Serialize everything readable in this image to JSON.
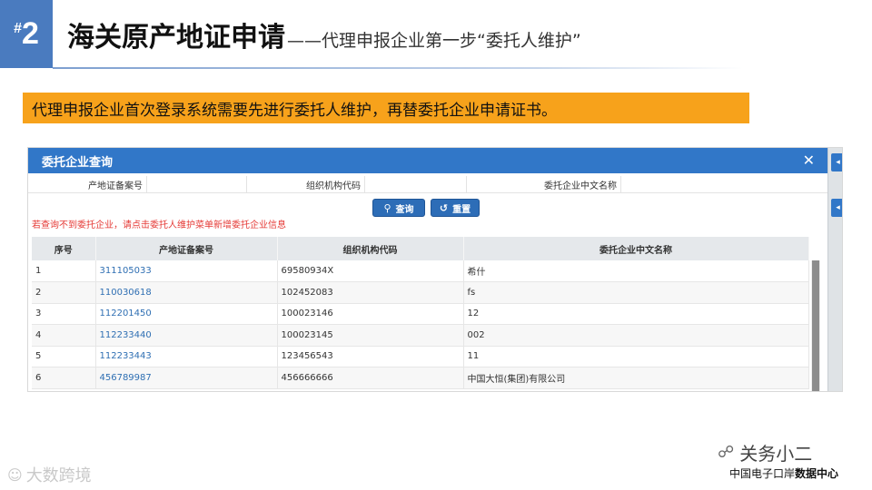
{
  "slide": {
    "number_prefix": "#",
    "number": "2",
    "title": "海关原产地证申请",
    "subtitle": "——代理申报企业第一步“委托人维护”",
    "callout": "代理申报企业首次登录系统需要先进行委托人维护，再替委托企业申请证书。"
  },
  "dialog": {
    "title": "委托企业查询",
    "close_icon": "close-icon",
    "filters": [
      {
        "label": "产地证备案号",
        "value": ""
      },
      {
        "label": "组织机构代码",
        "value": ""
      },
      {
        "label": "委托企业中文名称",
        "value": ""
      }
    ],
    "buttons": {
      "query": {
        "label": "查询",
        "icon": "search-icon"
      },
      "reset": {
        "label": "重置",
        "icon": "reset-icon"
      }
    },
    "hint": "若查询不到委托企业，请点击委托人维护菜单新增委托企业信息",
    "table": {
      "columns": [
        "序号",
        "产地证备案号",
        "组织机构代码",
        "委托企业中文名称"
      ],
      "rows": [
        [
          "1",
          "311105033",
          "69580934X",
          "希什"
        ],
        [
          "2",
          "110030618",
          "102452083",
          "fs"
        ],
        [
          "3",
          "112201450",
          "100023146",
          "12"
        ],
        [
          "4",
          "112233440",
          "100023145",
          "002"
        ],
        [
          "5",
          "112233443",
          "123456543",
          "11"
        ],
        [
          "6",
          "456789987",
          "456666666",
          "中国大恒(集团)有限公司"
        ]
      ]
    }
  },
  "watermarks": {
    "left": "大数跨境",
    "right": "关务小二",
    "footer_org_prefix": "中国电子口岸",
    "footer_org_suffix": "数据中心"
  },
  "colors": {
    "badge": "#4a7bbf",
    "callout": "#f7a21b",
    "dialog_header": "#3177c8",
    "link": "#2f6fb3",
    "hint": "#e53935"
  }
}
